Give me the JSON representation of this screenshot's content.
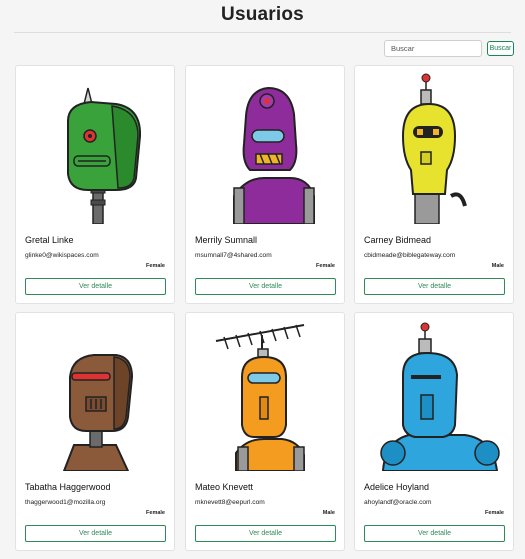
{
  "page": {
    "title": "Usuarios"
  },
  "search": {
    "placeholder": "Buscar",
    "button_label": "Buscar"
  },
  "colors": {
    "accent": "#198754"
  },
  "users": [
    {
      "name": "Gretal Linke",
      "email": "glinke0@wikispaces.com",
      "gender": "Female",
      "button_label": "Ver detalle",
      "avatar_icon": "green-robot-avatar",
      "robot_color": "#3aa23a"
    },
    {
      "name": "Merrily Sumnall",
      "email": "msumnall7@4shared.com",
      "gender": "Female",
      "button_label": "Ver detalle",
      "avatar_icon": "purple-robot-avatar",
      "robot_color": "#8e2c9c"
    },
    {
      "name": "Carney Bidmead",
      "email": "cbidmeade@biblegateway.com",
      "gender": "Male",
      "button_label": "Ver detalle",
      "avatar_icon": "yellow-robot-avatar",
      "robot_color": "#e6e22e"
    },
    {
      "name": "Tabatha Haggerwood",
      "email": "thaggerwood1@mozilla.org",
      "gender": "Female",
      "button_label": "Ver detalle",
      "avatar_icon": "brown-robot-avatar",
      "robot_color": "#8a5a3a"
    },
    {
      "name": "Mateo Knevett",
      "email": "mknevett8@eepurl.com",
      "gender": "Male",
      "button_label": "Ver detalle",
      "avatar_icon": "orange-robot-avatar",
      "robot_color": "#f39c1f"
    },
    {
      "name": "Adelice Hoyland",
      "email": "ahoylandf@oracle.com",
      "gender": "Female",
      "button_label": "Ver detalle",
      "avatar_icon": "blue-robot-avatar",
      "robot_color": "#2fa5dd"
    }
  ]
}
